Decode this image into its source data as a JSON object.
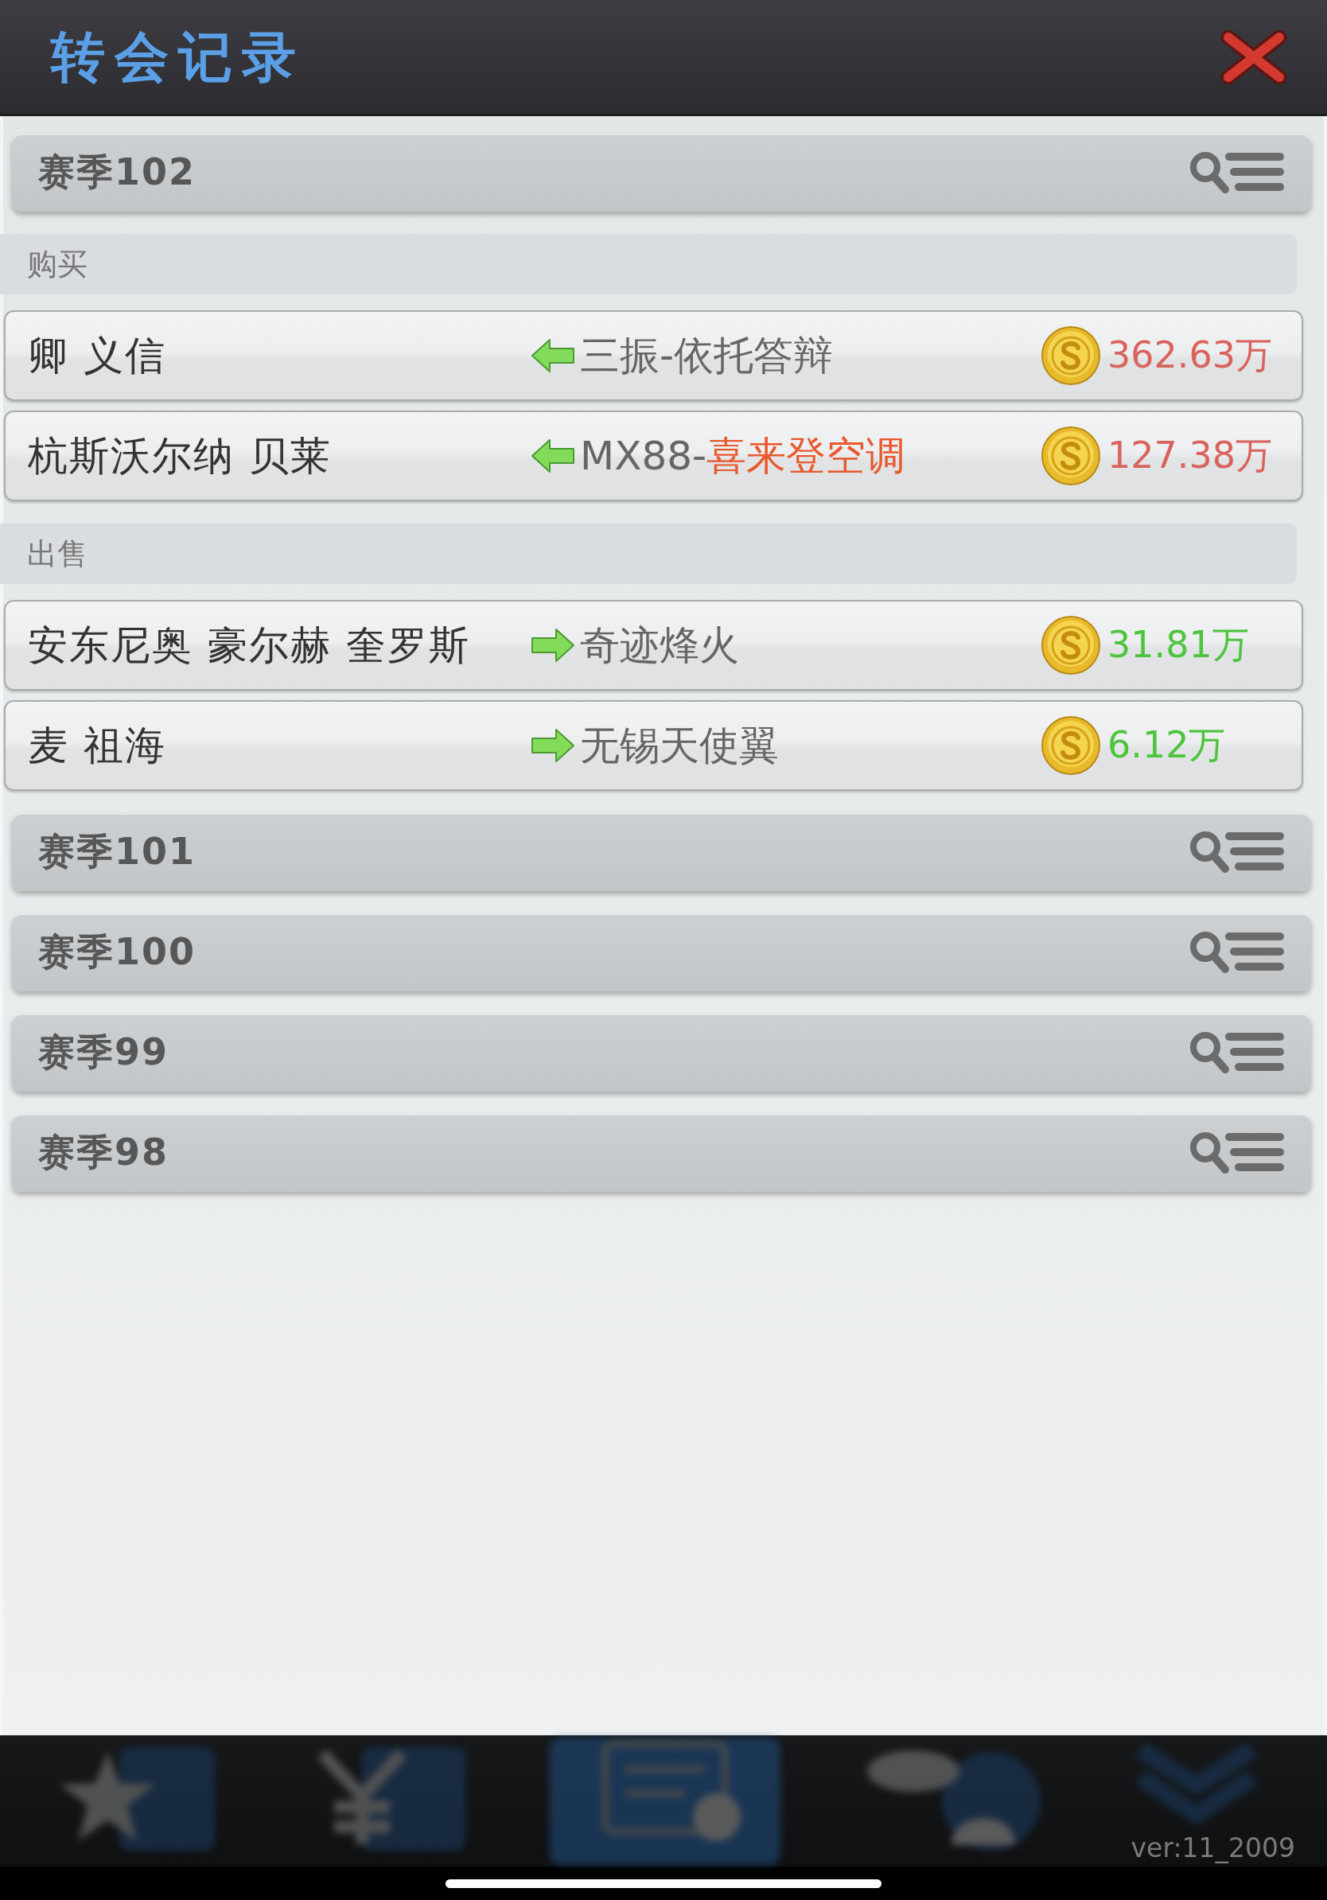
{
  "window": {
    "title": "转会记录"
  },
  "seasons": [
    {
      "label": "赛季102",
      "sections": [
        {
          "kind": "buy",
          "heading": "购买",
          "records": [
            {
              "player": "卿 义信",
              "club": [
                {
                  "text": "三振-依托答辩",
                  "highlight": false
                }
              ],
              "amount": "362.63万"
            },
            {
              "player": "杭斯沃尔纳 贝莱",
              "club": [
                {
                  "text": "MX88-",
                  "highlight": false
                },
                {
                  "text": "喜来登空调",
                  "highlight": true
                }
              ],
              "amount": "127.38万"
            }
          ]
        },
        {
          "kind": "sell",
          "heading": "出售",
          "records": [
            {
              "player": "安东尼奥 豪尔赫 奎罗斯",
              "club": [
                {
                  "text": "奇迹烽火",
                  "highlight": false
                }
              ],
              "amount": "31.81万"
            },
            {
              "player": "麦 祖海",
              "club": [
                {
                  "text": "无锡天使翼",
                  "highlight": false
                }
              ],
              "amount": "6.12万"
            }
          ]
        }
      ]
    },
    {
      "label": "赛季101"
    },
    {
      "label": "赛季100"
    },
    {
      "label": "赛季99"
    },
    {
      "label": "赛季98"
    }
  ],
  "bottom_bar": {
    "version": "ver:11_2009"
  }
}
